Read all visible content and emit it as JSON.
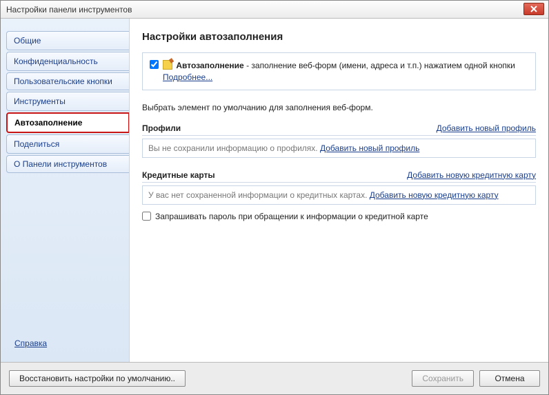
{
  "window": {
    "title": "Настройки панели инструментов"
  },
  "sidebar": {
    "items": [
      {
        "label": "Общие",
        "active": false
      },
      {
        "label": "Конфиденциальность",
        "active": false
      },
      {
        "label": "Пользовательские кнопки",
        "active": false
      },
      {
        "label": "Инструменты",
        "active": false
      },
      {
        "label": "Автозаполнение",
        "active": true
      },
      {
        "label": "Поделиться",
        "active": false
      },
      {
        "label": "О Панели инструментов",
        "active": false
      }
    ],
    "help": "Справка"
  },
  "page": {
    "title": "Настройки автозаполнения",
    "autofill": {
      "checked": true,
      "name": "Автозаполнение",
      "desc": " - заполнение веб-форм (имени, адреса и т.п.) нажатием одной кнопки  ",
      "more": "Подробнее..."
    },
    "default_desc": "Выбрать элемент по умолчанию для заполнения веб-форм.",
    "profiles": {
      "title": "Профили",
      "add_link": "Добавить новый профиль",
      "empty": "Вы не сохранили информацию о профилях. ",
      "empty_link": "Добавить новый профиль"
    },
    "cards": {
      "title": "Кредитные карты",
      "add_link": "Добавить новую кредитную карту",
      "empty": "У вас нет сохраненной информации о кредитных картах. ",
      "empty_link": "Добавить новую кредитную карту"
    },
    "pw_prompt": {
      "checked": false,
      "label": "Запрашивать пароль при обращении к информации о кредитной карте"
    }
  },
  "footer": {
    "restore": "Восстановить настройки по умолчанию..",
    "save": "Сохранить",
    "cancel": "Отмена"
  }
}
